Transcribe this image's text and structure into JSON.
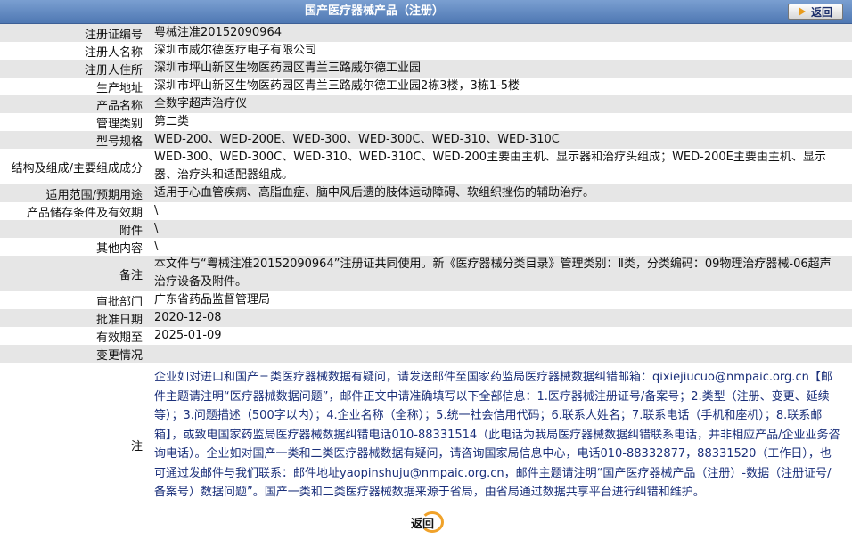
{
  "header": {
    "title": "国产医疗器械产品（注册）",
    "back_label": "返回"
  },
  "fields": [
    {
      "label": "注册证编号",
      "value": "粤械注准20152090964"
    },
    {
      "label": "注册人名称",
      "value": "深圳市威尔德医疗电子有限公司"
    },
    {
      "label": "注册人住所",
      "value": "深圳市坪山新区生物医药园区青兰三路威尔德工业园"
    },
    {
      "label": "生产地址",
      "value": "深圳市坪山新区生物医药园区青兰三路威尔德工业园2栋3楼，3栋1-5楼"
    },
    {
      "label": "产品名称",
      "value": "全数字超声治疗仪"
    },
    {
      "label": "管理类别",
      "value": "第二类"
    },
    {
      "label": "型号规格",
      "value": "WED-200、WED-200E、WED-300、WED-300C、WED-310、WED-310C"
    },
    {
      "label": "结构及组成/主要组成成分",
      "value": "WED-300、WED-300C、WED-310、WED-310C、WED-200主要由主机、显示器和治疗头组成；WED-200E主要由主机、显示器、治疗头和适配器组成。"
    },
    {
      "label": "适用范围/预期用途",
      "value": "适用于心血管疾病、高脂血症、脑中风后遗的肢体运动障碍、软组织挫伤的辅助治疗。"
    },
    {
      "label": "产品储存条件及有效期",
      "value": "\\"
    },
    {
      "label": "附件",
      "value": "\\"
    },
    {
      "label": "其他内容",
      "value": "\\"
    },
    {
      "label": "备注",
      "value": "本文件与“粤械注准20152090964”注册证共同使用。新《医疗器械分类目录》管理类别：Ⅱ类，分类编码：09物理治疗器械-06超声治疗设备及附件。"
    },
    {
      "label": "审批部门",
      "value": "广东省药品监督管理局"
    },
    {
      "label": "批准日期",
      "value": "2020-12-08"
    },
    {
      "label": "有效期至",
      "value": "2025-01-09"
    },
    {
      "label": "变更情况",
      "value": ""
    }
  ],
  "note": {
    "label": "注",
    "text": "企业如对进口和国产三类医疗器械数据有疑问，请发送邮件至国家药监局医疗器械数据纠错邮箱：qixiejiucuo@nmpaic.org.cn【邮件主题请注明“医疗器械数据问题”，邮件正文中请准确填写以下全部信息：1.医疗器械注册证号/备案号；2.类型（注册、变更、延续等）；3.问题描述（500字以内）；4.企业名称（全称）；5.统一社会信用代码；6.联系人姓名；7.联系电话（手机和座机）；8.联系邮箱】，或致电国家药监局医疗器械数据纠错电话010-88331514（此电话为我局医疗器械数据纠错联系电话，并非相应产品/企业业务咨询电话）。企业如对国产一类和二类医疗器械数据有疑问，请咨询国家局信息中心，电话010-88332877，88331520（工作日），也可通过发邮件与我们联系：邮件地址yaopinshuju@nmpaic.org.cn，邮件主题请注明“国产医疗器械产品（注册）-数据（注册证号/备案号）数据问题”。国产一类和二类医疗器械数据来源于省局，由省局通过数据共享平台进行纠错和维护。"
  },
  "footer": {
    "back_label": "返回"
  }
}
